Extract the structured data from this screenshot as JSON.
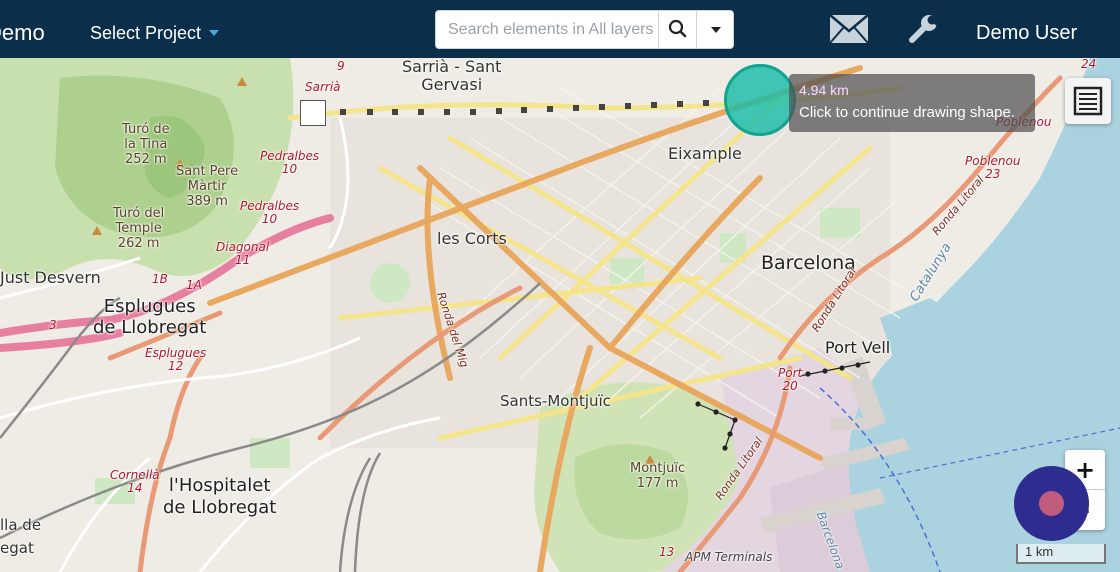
{
  "navbar": {
    "brand": "Demo",
    "project_select": "Select Project",
    "search": {
      "placeholder": "Search elements in All layers"
    },
    "user_menu": "Demo User",
    "icons": {
      "search": "search-icon",
      "mail": "mail-icon",
      "tools": "wrench-icon",
      "dropdown": "caret-down-icon"
    }
  },
  "map": {
    "labels": {
      "sarria_gervasi": "Sarrià - Sant\nGervasi",
      "sarria": "Sarrià",
      "sarria_number": "9",
      "turo_tina": "Turó de\nla Tina\n252 m",
      "sant_pere_martir": "Sant Pere\nMàrtir\n389 m",
      "turo_temple": "Turó del\nTemple\n262 m",
      "pedralbes_10a": "Pedralbes\n10",
      "pedralbes_10b": "Pedralbes\n10",
      "diagonal_11": "Diagonal\n11",
      "sant_just": "Just Desvern",
      "road_1b": "1B",
      "road_1a": "1A",
      "road_3": "3",
      "esplugues": "Esplugues\nde Llobregat",
      "esplugues_12": "Esplugues\n12",
      "les_corts": "les Corts",
      "ronda_mig": "Ronda del Mig",
      "eixample": "Eixample",
      "barcelona": "Barcelona",
      "poblenou": "Poblenou",
      "poblenou_23": "Poblenou\n23",
      "number_24": "24",
      "ronda_litoral_ne": "Ronda Litoral",
      "ronda_litoral_port": "Ronda Litoral",
      "catalunya": "Catalunya",
      "port_vell": "Port Vell",
      "port_20": "Port\n20",
      "sants_montjuic": "Sants-Montjuïc",
      "montjuic": "Montjuïc\n177 m",
      "ronda_litoral_s": "Ronda Litoral",
      "cornella_14": "Cornellà\n14",
      "hospitalet": "l'Hospitalet\nde Llobregat",
      "lla_de": "lla de",
      "egat": "egat",
      "apm": "APM Terminals",
      "number_13": "13",
      "barcelona_bay": "Barcelona"
    },
    "measure": {
      "distance": "4.94 km",
      "hint": "Click to continue drawing shape."
    },
    "controls": {
      "zoom_in": "+",
      "zoom_out": "-",
      "scale": "1 km",
      "legend_icon": "list-icon",
      "location_icon": "geolocation-icon"
    }
  }
}
